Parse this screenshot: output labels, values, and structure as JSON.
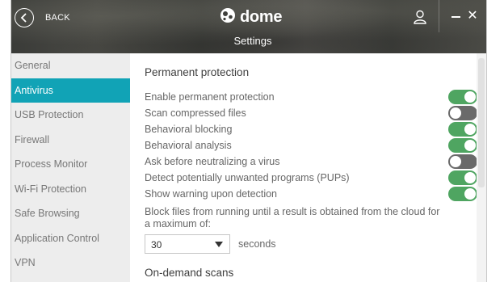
{
  "header": {
    "back_label": "BACK",
    "logo_text": "dome",
    "title": "Settings"
  },
  "sidebar": {
    "items": [
      {
        "label": "General",
        "active": false
      },
      {
        "label": "Antivirus",
        "active": true
      },
      {
        "label": "USB Protection",
        "active": false
      },
      {
        "label": "Firewall",
        "active": false
      },
      {
        "label": "Process Monitor",
        "active": false
      },
      {
        "label": "Wi-Fi Protection",
        "active": false
      },
      {
        "label": "Safe Browsing",
        "active": false
      },
      {
        "label": "Application Control",
        "active": false
      },
      {
        "label": "VPN",
        "active": false
      }
    ]
  },
  "main": {
    "permanent_title": "Permanent protection",
    "options": [
      {
        "label": "Enable permanent protection",
        "enabled": true
      },
      {
        "label": "Scan compressed files",
        "enabled": false
      },
      {
        "label": "Behavioral blocking",
        "enabled": true
      },
      {
        "label": "Behavioral analysis",
        "enabled": true
      },
      {
        "label": "Ask before neutralizing a virus",
        "enabled": false
      },
      {
        "label": "Detect potentially unwanted programs (PUPs)",
        "enabled": true
      },
      {
        "label": "Show warning upon detection",
        "enabled": true
      }
    ],
    "block_text": "Block files from running until a result is obtained from the cloud for a maximum of:",
    "block_value": "30",
    "block_unit": "seconds",
    "ondemand_title": "On-demand scans"
  },
  "colors": {
    "accent": "#11a3b6",
    "toggle_on": "#4fa561",
    "toggle_off": "#6a6a6a",
    "sidebar_bg": "#ededed"
  },
  "icons": {
    "back": "chevron-left-icon",
    "logo": "panda-logo-icon",
    "user": "user-icon",
    "minimize": "minimize-icon",
    "close": "close-icon",
    "dropdown": "caret-down-icon"
  }
}
